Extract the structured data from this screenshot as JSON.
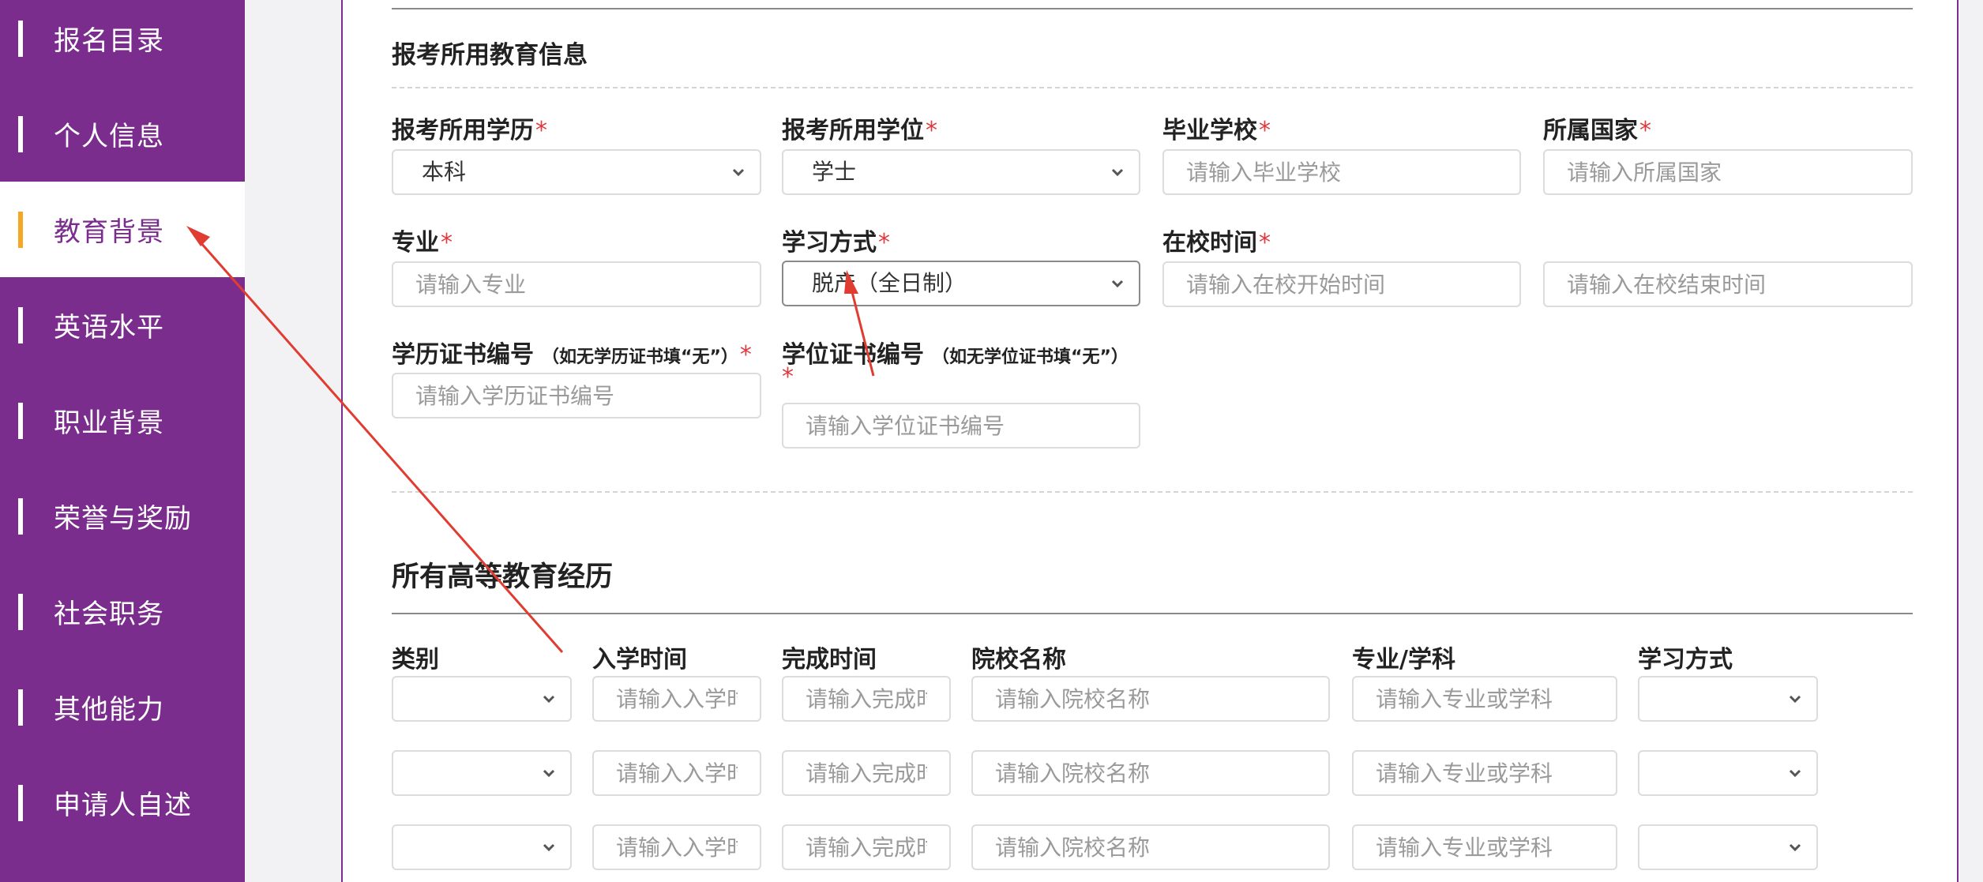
{
  "sidebar": {
    "items": [
      {
        "label": "报名目录"
      },
      {
        "label": "个人信息"
      },
      {
        "label": "教育背景"
      },
      {
        "label": "英语水平"
      },
      {
        "label": "职业背景"
      },
      {
        "label": "荣誉与奖励"
      },
      {
        "label": "社会职务"
      },
      {
        "label": "其他能力"
      },
      {
        "label": "申请人自述"
      }
    ]
  },
  "section1": {
    "title": "报考所用教育信息",
    "degree_label": "报考所用学历",
    "degree_value": "本科",
    "deg2_label": "报考所用学位",
    "deg2_value": "学士",
    "school_label": "毕业学校",
    "school_placeholder": "请输入毕业学校",
    "country_label": "所属国家",
    "country_placeholder": "请输入所属国家",
    "major_label": "专业",
    "major_placeholder": "请输入专业",
    "mode_label": "学习方式",
    "mode_value": "脱产（全日制）",
    "time_label": "在校时间",
    "start_placeholder": "请输入在校开始时间",
    "end_placeholder": "请输入在校结束时间",
    "cert_label": "学历证书编号",
    "cert_note": "（如无学历证书填“无”）",
    "cert_placeholder": "请输入学历证书编号",
    "dcert_label": "学位证书编号",
    "dcert_note": "（如无学位证书填“无”）",
    "dcert_placeholder": "请输入学位证书编号",
    "required_mark": "*"
  },
  "section2": {
    "title": "所有高等教育经历",
    "headers": {
      "category": "类别",
      "start": "入学时间",
      "finish": "完成时间",
      "school": "院校名称",
      "major": "专业/学科",
      "mode": "学习方式"
    },
    "row_placeholders": {
      "start": "请输入入学时间",
      "finish": "请输入完成时间",
      "school": "请输入院校名称",
      "major": "请输入专业或学科"
    }
  }
}
